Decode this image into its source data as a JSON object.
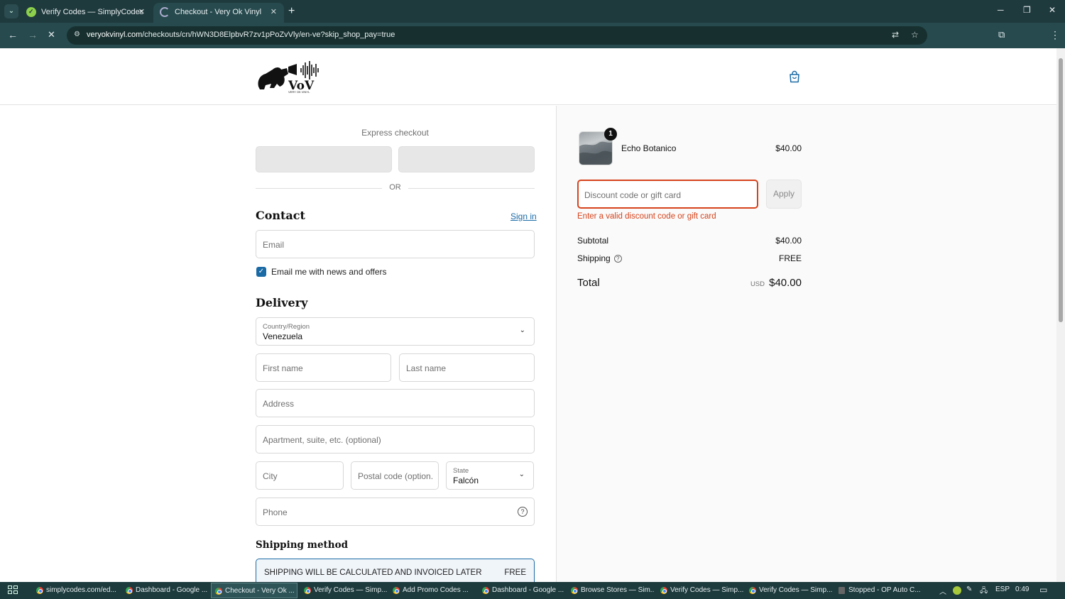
{
  "browser": {
    "tabs": [
      {
        "title": "Verify Codes — SimplyCodes",
        "active": false
      },
      {
        "title": "Checkout - Very Ok Vinyl",
        "active": true
      }
    ],
    "url_domain": "veryokvinyl.com",
    "url_path": "/checkouts/cn/hWN3D8ElpbvR7zv1pPoZvVly/en-ve?skip_shop_pay=true"
  },
  "store": {
    "logo_text": "VoV",
    "logo_subtext": "VERY OK VINYL"
  },
  "checkout": {
    "express_label": "Express checkout",
    "or_label": "OR",
    "contact": {
      "heading": "Contact",
      "signin_label": "Sign in",
      "email_placeholder": "Email",
      "newsletter_label": "Email me with news and offers",
      "newsletter_checked": true
    },
    "delivery": {
      "heading": "Delivery",
      "country_label": "Country/Region",
      "country_value": "Venezuela",
      "first_name_placeholder": "First name",
      "last_name_placeholder": "Last name",
      "address_placeholder": "Address",
      "apartment_placeholder": "Apartment, suite, etc. (optional)",
      "city_placeholder": "City",
      "postal_placeholder": "Postal code (option...",
      "state_label": "State",
      "state_value": "Falcón",
      "phone_placeholder": "Phone"
    },
    "shipping_method": {
      "heading": "Shipping method",
      "option_text": "SHIPPING WILL BE CALCULATED AND INVOICED LATER",
      "option_price": "FREE"
    }
  },
  "summary": {
    "item": {
      "name": "Echo Botanico",
      "price": "$40.00",
      "quantity": "1"
    },
    "discount_placeholder": "Discount code or gift card",
    "apply_label": "Apply",
    "error_text": "Enter a valid discount code or gift card",
    "subtotal_label": "Subtotal",
    "subtotal_value": "$40.00",
    "shipping_label": "Shipping",
    "shipping_value": "FREE",
    "total_label": "Total",
    "total_currency": "USD",
    "total_value": "$40.00"
  },
  "taskbar": {
    "items": [
      {
        "label": "simplycodes.com/ed...",
        "icon": "chrome-icon",
        "active": false
      },
      {
        "label": "Dashboard - Google ...",
        "icon": "chrome-icon",
        "active": false
      },
      {
        "label": "Checkout - Very Ok ...",
        "icon": "chrome-icon",
        "active": true
      },
      {
        "label": "Verify Codes — Simp...",
        "icon": "chrome-icon",
        "active": false
      },
      {
        "label": "Add Promo Codes ...",
        "icon": "chrome-icon",
        "active": false
      },
      {
        "label": "Dashboard - Google ...",
        "icon": "chrome-icon",
        "active": false
      },
      {
        "label": "Browse Stores — Sim...",
        "icon": "chrome-icon",
        "active": false
      },
      {
        "label": "Verify Codes — Simp...",
        "icon": "chrome-icon",
        "active": false
      },
      {
        "label": "Verify Codes — Simp...",
        "icon": "chrome-icon",
        "active": false
      },
      {
        "label": "Stopped - OP Auto C...",
        "icon": "app-icon",
        "active": false
      }
    ],
    "language": "ESP",
    "time": "0:49"
  },
  "colors": {
    "accent": "#1a6aa6",
    "error": "#d6431c",
    "chrome_bg": "#264a4e"
  }
}
